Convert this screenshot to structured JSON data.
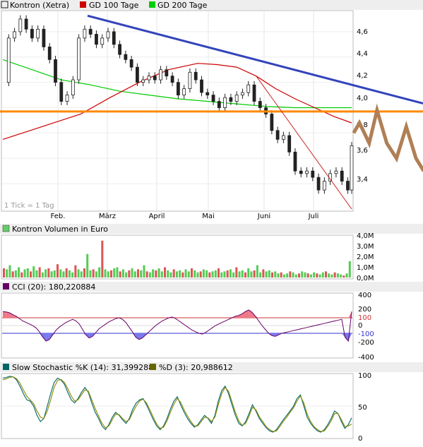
{
  "price_panel": {
    "legend": [
      {
        "label": "Kontron (Xetra)",
        "color": "#1a1a1a"
      },
      {
        "label": "GD 100 Tage",
        "color": "#cc0000"
      },
      {
        "label": "GD 200 Tage",
        "color": "#00cc00"
      }
    ],
    "y_ticks": [
      "4,6",
      "4,4",
      "4,2",
      "4,0",
      "3,8",
      "3,6",
      "3,4"
    ],
    "x_ticks": [
      "Feb.",
      "März",
      "April",
      "Mai",
      "Juni",
      "Juli"
    ],
    "tick_note": "1 Tick = 1 Tag"
  },
  "volume_panel": {
    "legend": {
      "label": "Kontron Volumen in Euro",
      "color": "#66cc66"
    },
    "y_ticks": [
      "4,0M",
      "3,0M",
      "2,0M",
      "1,0M",
      "0,0M"
    ]
  },
  "cci_panel": {
    "legend": {
      "label": "CCI (20): 180,220884",
      "color": "#660066"
    },
    "y_ticks": [
      "400",
      "200",
      "100",
      "0",
      "-100",
      "-200",
      "-400"
    ]
  },
  "stoch_panel": {
    "legend": [
      {
        "label": "Slow Stochastic %K (14): 31,399288",
        "color": "#006666"
      },
      {
        "label": "%D (3): 20,988612",
        "color": "#666600"
      }
    ],
    "y_ticks": [
      "100",
      "50",
      "0"
    ]
  },
  "chart_data": [
    {
      "type": "candlestick",
      "title": "Kontron (Xetra)",
      "x_ticks": [
        "Feb.",
        "März",
        "April",
        "Mai",
        "Juni",
        "Juli"
      ],
      "ylim": [
        3.2,
        4.75
      ],
      "close_series": [
        [
          0,
          4.2
        ],
        [
          3,
          4.55
        ],
        [
          6,
          4.6
        ],
        [
          9,
          4.7
        ],
        [
          12,
          4.62
        ],
        [
          15,
          4.55
        ],
        [
          18,
          4.62
        ],
        [
          21,
          4.48
        ],
        [
          24,
          4.38
        ],
        [
          27,
          4.2
        ],
        [
          30,
          4.05
        ],
        [
          33,
          4.1
        ],
        [
          36,
          4.22
        ],
        [
          39,
          4.55
        ],
        [
          42,
          4.62
        ],
        [
          45,
          4.58
        ],
        [
          48,
          4.5
        ],
        [
          51,
          4.55
        ],
        [
          54,
          4.6
        ],
        [
          57,
          4.5
        ],
        [
          60,
          4.42
        ],
        [
          63,
          4.38
        ],
        [
          66,
          4.32
        ],
        [
          69,
          4.2
        ],
        [
          72,
          4.22
        ],
        [
          75,
          4.25
        ],
        [
          78,
          4.22
        ],
        [
          81,
          4.3
        ],
        [
          84,
          4.25
        ],
        [
          87,
          4.2
        ],
        [
          90,
          4.1
        ],
        [
          93,
          4.15
        ],
        [
          96,
          4.28
        ],
        [
          99,
          4.22
        ],
        [
          102,
          4.12
        ],
        [
          105,
          4.1
        ],
        [
          108,
          4.05
        ],
        [
          111,
          4.0
        ],
        [
          114,
          4.08
        ],
        [
          117,
          4.05
        ],
        [
          120,
          4.1
        ],
        [
          123,
          4.12
        ],
        [
          126,
          4.18
        ],
        [
          129,
          4.05
        ],
        [
          132,
          4.0
        ],
        [
          135,
          3.95
        ],
        [
          138,
          3.82
        ],
        [
          141,
          3.75
        ],
        [
          144,
          3.78
        ],
        [
          147,
          3.65
        ],
        [
          150,
          3.5
        ],
        [
          153,
          3.48
        ],
        [
          156,
          3.5
        ],
        [
          159,
          3.45
        ],
        [
          162,
          3.35
        ],
        [
          165,
          3.42
        ],
        [
          168,
          3.48
        ],
        [
          171,
          3.5
        ],
        [
          174,
          3.42
        ],
        [
          177,
          3.35
        ],
        [
          179,
          3.7
        ]
      ],
      "gd100": [
        [
          0,
          3.75
        ],
        [
          20,
          3.85
        ],
        [
          40,
          3.95
        ],
        [
          55,
          4.08
        ],
        [
          70,
          4.2
        ],
        [
          85,
          4.3
        ],
        [
          100,
          4.35
        ],
        [
          110,
          4.34
        ],
        [
          120,
          4.32
        ],
        [
          130,
          4.25
        ],
        [
          140,
          4.15
        ],
        [
          150,
          4.07
        ],
        [
          160,
          4.0
        ],
        [
          170,
          3.93
        ],
        [
          179,
          3.88
        ]
      ],
      "gd200": [
        [
          0,
          4.38
        ],
        [
          15,
          4.3
        ],
        [
          30,
          4.22
        ],
        [
          45,
          4.18
        ],
        [
          60,
          4.13
        ],
        [
          75,
          4.1
        ],
        [
          90,
          4.07
        ],
        [
          105,
          4.05
        ],
        [
          120,
          4.03
        ],
        [
          135,
          4.01
        ],
        [
          150,
          4.0
        ],
        [
          165,
          4.0
        ],
        [
          179,
          4.0
        ]
      ],
      "horizontal_line": 3.97,
      "downtrend_line": [
        [
          0,
          4.72
        ],
        [
          179,
          4.0
        ]
      ],
      "steep_trend_line": [
        [
          130,
          4.25
        ],
        [
          179,
          3.2
        ]
      ],
      "projection": [
        [
          180,
          3.8
        ],
        [
          183,
          3.88
        ],
        [
          188,
          3.72
        ],
        [
          192,
          3.98
        ],
        [
          197,
          3.72
        ],
        [
          202,
          3.6
        ],
        [
          207,
          3.85
        ],
        [
          212,
          3.6
        ],
        [
          216,
          3.5
        ]
      ]
    },
    {
      "type": "bar",
      "title": "Kontron Volumen in Euro",
      "ylim": [
        0,
        4.0
      ],
      "unit": "M",
      "values": [
        0.9,
        0.8,
        1.2,
        0.6,
        0.7,
        1.0,
        0.5,
        0.8,
        0.9,
        0.6,
        1.1,
        0.7,
        1.0,
        0.5,
        0.8,
        0.9,
        0.6,
        0.7,
        1.3,
        0.8,
        0.6,
        0.9,
        0.7,
        0.5,
        1.2,
        0.8,
        0.6,
        0.9,
        2.3,
        0.7,
        0.8,
        0.6,
        1.0,
        3.6,
        0.8,
        0.6,
        0.7,
        0.9,
        1.0,
        0.6,
        0.8,
        0.5,
        0.7,
        0.9,
        0.6,
        0.8,
        0.7,
        1.2,
        0.6,
        0.5,
        0.8,
        0.7,
        0.9,
        0.6,
        1.0,
        0.7,
        0.5,
        0.8,
        0.6,
        0.7,
        0.5,
        0.8,
        0.6,
        0.9,
        0.7,
        0.5,
        0.6,
        0.8,
        0.7,
        0.5,
        0.6,
        0.7,
        0.9,
        0.5,
        0.6,
        0.7,
        0.8,
        0.5,
        1.0,
        0.6,
        0.7,
        0.5,
        0.9,
        0.6,
        0.7,
        1.2,
        0.5,
        0.8,
        0.6,
        0.7,
        0.5,
        0.6,
        0.4,
        0.5,
        0.3,
        0.4,
        0.6,
        0.5,
        0.3,
        0.4,
        0.6,
        0.5,
        0.4,
        0.3,
        0.5,
        0.4,
        0.3,
        0.5,
        0.6,
        0.4,
        0.3,
        0.5,
        0.4,
        0.3,
        0.2,
        0.4,
        1.6
      ]
    },
    {
      "type": "line",
      "title": "CCI (20)",
      "ylim": [
        -400,
        400
      ],
      "reference_lines": [
        100,
        -100
      ],
      "values": [
        180,
        175,
        165,
        140,
        120,
        90,
        60,
        40,
        20,
        0,
        -30,
        -80,
        -150,
        -200,
        -180,
        -120,
        -60,
        -20,
        10,
        40,
        60,
        80,
        60,
        20,
        -50,
        -120,
        -160,
        -140,
        -90,
        -40,
        -10,
        20,
        50,
        70,
        90,
        100,
        80,
        40,
        -20,
        -80,
        -150,
        -180,
        -160,
        -120,
        -80,
        -40,
        0,
        30,
        60,
        80,
        100,
        110,
        90,
        60,
        30,
        0,
        -30,
        -60,
        -80,
        -100,
        -110,
        -90,
        -60,
        -30,
        0,
        20,
        40,
        60,
        80,
        100,
        120,
        130,
        150,
        180,
        200,
        170,
        120,
        60,
        0,
        -50,
        -100,
        -130,
        -140,
        -120,
        -100,
        -90,
        -80,
        -70,
        -60,
        -50,
        -40,
        -30,
        -20,
        -10,
        0,
        10,
        20,
        30,
        40,
        50,
        60,
        70,
        80,
        -150,
        -200,
        180
      ]
    },
    {
      "type": "line",
      "title": "Slow Stochastic",
      "ylim": [
        0,
        100
      ],
      "series": [
        {
          "name": "Slow Stochastic %K (14): 31,399288",
          "values": [
            95,
            96,
            98,
            97,
            92,
            82,
            70,
            60,
            58,
            50,
            35,
            25,
            30,
            50,
            70,
            88,
            95,
            92,
            85,
            72,
            60,
            55,
            62,
            72,
            80,
            72,
            55,
            40,
            30,
            18,
            12,
            20,
            32,
            40,
            35,
            28,
            22,
            30,
            45,
            55,
            60,
            62,
            52,
            40,
            28,
            18,
            12,
            18,
            30,
            45,
            58,
            65,
            52,
            40,
            30,
            22,
            16,
            20,
            28,
            35,
            30,
            22,
            35,
            58,
            75,
            82,
            70,
            52,
            35,
            22,
            18,
            25,
            38,
            52,
            42,
            30,
            22,
            15,
            10,
            8,
            12,
            20,
            28,
            35,
            42,
            50,
            62,
            68,
            50,
            32,
            22,
            15,
            10,
            8,
            12,
            20,
            30,
            42,
            38,
            25,
            14,
            20,
            31
          ]
        },
        {
          "name": "%D (3): 20,988612",
          "values": [
            92,
            94,
            96,
            97,
            94,
            87,
            76,
            66,
            60,
            54,
            42,
            32,
            30,
            42,
            60,
            80,
            91,
            93,
            88,
            78,
            66,
            58,
            60,
            68,
            76,
            74,
            60,
            46,
            34,
            22,
            15,
            18,
            28,
            37,
            36,
            30,
            25,
            28,
            40,
            50,
            58,
            61,
            55,
            44,
            32,
            21,
            14,
            16,
            26,
            40,
            53,
            62,
            56,
            44,
            34,
            25,
            18,
            18,
            25,
            32,
            31,
            25,
            32,
            52,
            70,
            80,
            74,
            57,
            40,
            26,
            19,
            22,
            34,
            48,
            44,
            33,
            25,
            17,
            12,
            9,
            10,
            17,
            25,
            32,
            40,
            47,
            58,
            66,
            55,
            37,
            25,
            17,
            12,
            9,
            10,
            17,
            26,
            38,
            38,
            28,
            17,
            18,
            21
          ]
        }
      ]
    }
  ]
}
